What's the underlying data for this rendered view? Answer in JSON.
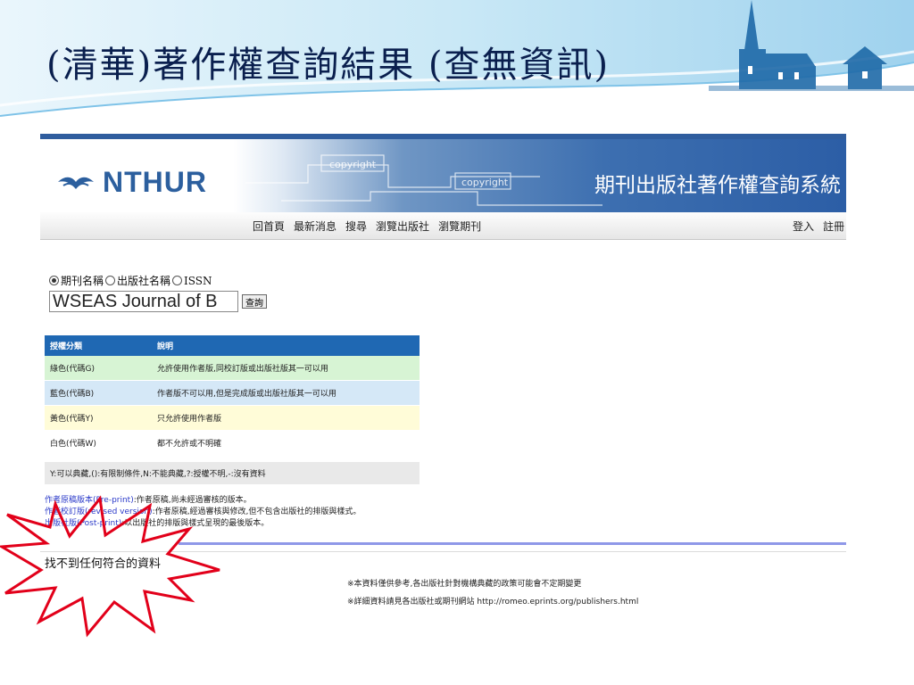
{
  "slide": {
    "title": "(清華)著作權查詢結果 (查無資訊)"
  },
  "app": {
    "logo_text": "NTHUR",
    "banner_words": [
      "copyright",
      "copyright"
    ],
    "system_title": "期刊出版社著作權查詢系統",
    "nav": [
      "回首頁",
      "最新消息",
      "搜尋",
      "瀏覽出版社",
      "瀏覽期刊"
    ],
    "nav_right": [
      "登入",
      "註冊"
    ]
  },
  "search": {
    "radios": [
      {
        "label": "期刊名稱",
        "checked": true
      },
      {
        "label": "出版社名稱",
        "checked": false
      },
      {
        "label": "ISSN",
        "checked": false
      }
    ],
    "value": "WSEAS Journal of B",
    "button": "查詢"
  },
  "legend": {
    "headers": [
      "授權分類",
      "說明"
    ],
    "rows": [
      {
        "category": "綠色(代碼G)",
        "desc": "允許使用作者版,同校訂版或出版社版其一可以用",
        "color": "#d7f4d4"
      },
      {
        "category": "藍色(代碼B)",
        "desc": "作者版不可以用,但是完成版或出版社版其一可以用",
        "color": "#d5e8f7"
      },
      {
        "category": "黃色(代碼Y)",
        "desc": "只允許使用作者版",
        "color": "#fffcd8"
      },
      {
        "category": "白色(代碼W)",
        "desc": "都不允許或不明確",
        "color": "#ffffff"
      }
    ],
    "note": "Y:可以典藏,():有限制條件,N:不能典藏,?:授權不明,-:沒有資料"
  },
  "definitions": [
    {
      "link": "作者原稿版本(Pre-print)",
      "text": ":作者原稿,尚未經過審核的版本。"
    },
    {
      "link": "作者校訂版(revised version)",
      "text": ":作者原稿,經過審核與修改,但不包含出版社的排版與樣式。"
    },
    {
      "link": "出版社版(Post-print)",
      "text": ":以出版社的排版與樣式呈現的最後版本。"
    }
  ],
  "result": {
    "message": "找不到任何符合的資料"
  },
  "notes": [
    "※本資料僅供參考,各出版社針對機構典藏的政策可能會不定期變更",
    "※詳細資料請見各出版社或期刊網站 http://romeo.eprints.org/publishers.html"
  ],
  "colors": {
    "title": "#0a1f4e",
    "legend_header": "#1f68b3",
    "link": "#2a39c9",
    "burst": "#e2001a"
  }
}
